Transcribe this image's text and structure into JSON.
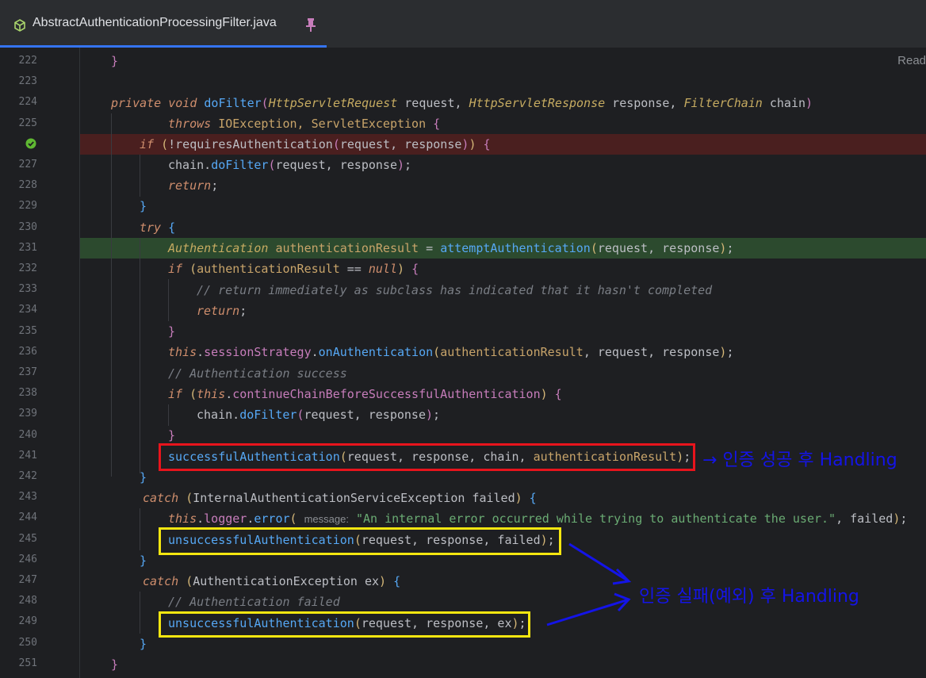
{
  "tab": {
    "title": "AbstractAuthenticationProcessingFilter.java",
    "icon": "java-class-icon",
    "pin_icon": "pin-icon"
  },
  "editor": {
    "reader_mode_label": "Read"
  },
  "lines": [
    {
      "num": "222"
    },
    {
      "num": "223"
    },
    {
      "num": "224"
    },
    {
      "num": "225"
    },
    {
      "num": ""
    },
    {
      "num": "227"
    },
    {
      "num": "228"
    },
    {
      "num": "229"
    },
    {
      "num": "230"
    },
    {
      "num": "231"
    },
    {
      "num": "232"
    },
    {
      "num": "233"
    },
    {
      "num": "234"
    },
    {
      "num": "235"
    },
    {
      "num": "236"
    },
    {
      "num": "237"
    },
    {
      "num": "238"
    },
    {
      "num": "239"
    },
    {
      "num": "240"
    },
    {
      "num": "241"
    },
    {
      "num": "242"
    },
    {
      "num": "243"
    },
    {
      "num": "244"
    },
    {
      "num": "245"
    },
    {
      "num": "246"
    },
    {
      "num": "247"
    },
    {
      "num": "248"
    },
    {
      "num": "249"
    },
    {
      "num": "250"
    },
    {
      "num": "251"
    }
  ],
  "code": {
    "l224": {
      "mods": "private void ",
      "name": "doFilter",
      "p1t": "HttpServletRequest",
      "p1": " request, ",
      "p2t": "HttpServletResponse",
      "p2": " response, ",
      "p3t": "FilterChain",
      "p3": " chain"
    },
    "l225": {
      "throws": "throws ",
      "ex": "IOException, ServletException "
    },
    "l226": {
      "if": "if ",
      "call": "requiresAuthentication",
      "args": "request, response"
    },
    "l227": {
      "obj": "chain.",
      "call": "doFilter",
      "args": "request, response"
    },
    "l228": {
      "kw": "return"
    },
    "l230": {
      "kw": "try "
    },
    "l231": {
      "type": "Authentication ",
      "var": "authenticationResult",
      "op": " = ",
      "call": "attemptAuthentication",
      "args": "request, response"
    },
    "l232": {
      "if": "if ",
      "var": "authenticationResult",
      "op": " == ",
      "nul": "null"
    },
    "l233": {
      "comment": "// return immediately as subclass has indicated that it hasn't completed"
    },
    "l234": {
      "kw": "return"
    },
    "l236": {
      "this": "this",
      "field": "sessionStrategy",
      "call": "onAuthentication",
      "var": "authenticationResult",
      "args": ", request, response"
    },
    "l237": {
      "comment": "// Authentication success"
    },
    "l238": {
      "if": "if ",
      "this": "this",
      "field": "continueChainBeforeSuccessfulAuthentication"
    },
    "l239": {
      "obj": "chain.",
      "call": "doFilter",
      "args": "request, response"
    },
    "l241": {
      "call": "successfulAuthentication",
      "args": "request, response, chain, ",
      "var": "authenticationResult"
    },
    "l243": {
      "kw": "catch ",
      "ex": "InternalAuthenticationServiceException",
      "p": " failed"
    },
    "l244": {
      "this": "this",
      "field": "logger",
      "call": "error",
      "hint": "message:",
      "str": "\"An internal error occurred while trying to authenticate the user.\"",
      "rest": ", failed"
    },
    "l245": {
      "call": "unsuccessfulAuthentication",
      "args": "request, response, failed"
    },
    "l247": {
      "kw": "catch ",
      "ex": "AuthenticationException",
      "p": " ex"
    },
    "l248": {
      "comment": "// Authentication failed"
    },
    "l249": {
      "call": "unsuccessfulAuthentication",
      "args": "request, response, ex"
    }
  },
  "annotations": {
    "success": "→ 인증 성공 후 Handling",
    "failure": "인증 실패(예외) 후 Handling"
  },
  "colors": {
    "success_box": "#e8141c",
    "failure_box": "#f5e610",
    "annotation_text": "#1414e8",
    "arrow": "#1414e8"
  }
}
